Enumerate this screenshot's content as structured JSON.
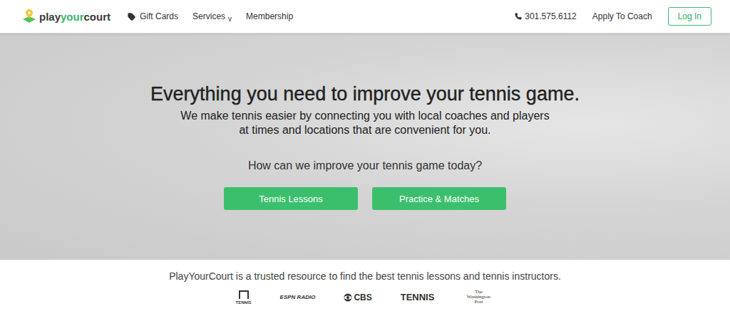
{
  "header": {
    "logo": {
      "first": "play",
      "accent": "your",
      "last": "court"
    },
    "nav": [
      {
        "label": "Gift Cards",
        "kind": "tag"
      },
      {
        "label": "Services",
        "kind": "dropdown",
        "caret": "v"
      },
      {
        "label": "Membership",
        "kind": "plain"
      }
    ],
    "phone": "301.575.6112",
    "apply": "Apply To Coach",
    "login": "Log In"
  },
  "hero": {
    "title": "Everything you need to improve your tennis game.",
    "subtitle": [
      "We make tennis easier by connecting you with local coaches and players",
      "at times and locations that are convenient for you."
    ],
    "prompt": "How can we improve your tennis game today?",
    "buttons": [
      "Tennis Lessons",
      "Practice & Matches"
    ]
  },
  "trust": {
    "text": "PlayYourCourt is a trusted resource to find the best tennis lessons and tennis instructors.",
    "logos": [
      {
        "label": "TENNIS",
        "kind": "channel"
      },
      {
        "label": "ESPN RADIO",
        "kind": "espn"
      },
      {
        "label": "CBS",
        "kind": "cbs"
      },
      {
        "label": "TENNIS",
        "kind": "magazine"
      },
      {
        "label": "The Washington Post",
        "kind": "post"
      }
    ]
  }
}
